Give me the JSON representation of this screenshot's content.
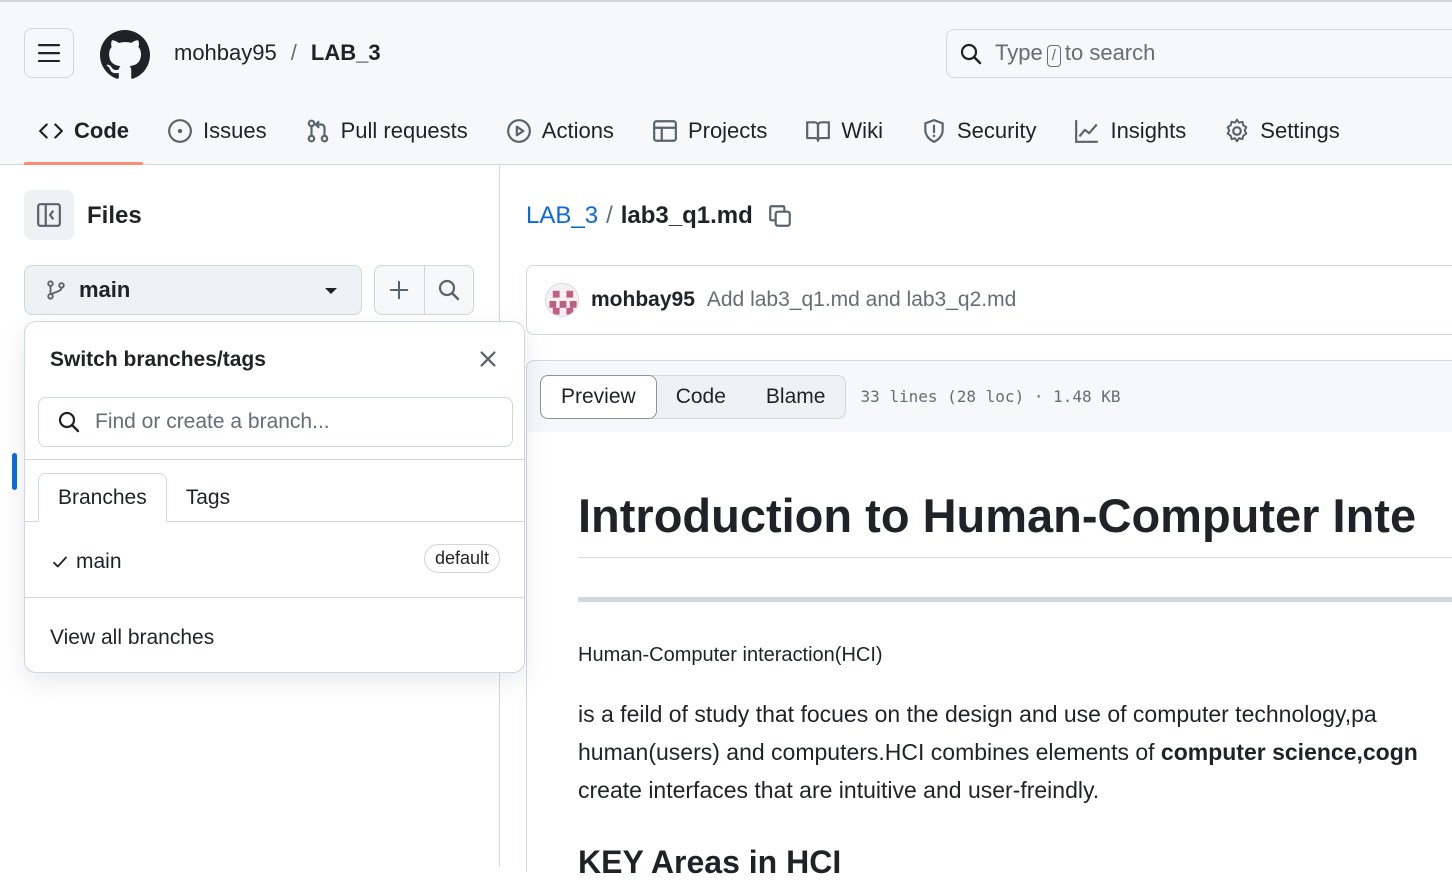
{
  "header": {
    "owner": "mohbay95",
    "separator": "/",
    "repo": "LAB_3",
    "search": {
      "prefix": "Type",
      "key": "/",
      "suffix": "to search"
    }
  },
  "tabs": [
    {
      "label": "Code",
      "icon": "code-icon",
      "active": true
    },
    {
      "label": "Issues",
      "icon": "issue-opened-icon"
    },
    {
      "label": "Pull requests",
      "icon": "git-pull-request-icon"
    },
    {
      "label": "Actions",
      "icon": "play-icon"
    },
    {
      "label": "Projects",
      "icon": "table-icon"
    },
    {
      "label": "Wiki",
      "icon": "book-icon"
    },
    {
      "label": "Security",
      "icon": "shield-icon"
    },
    {
      "label": "Insights",
      "icon": "graph-icon"
    },
    {
      "label": "Settings",
      "icon": "gear-icon"
    }
  ],
  "filepane": {
    "title": "Files",
    "branch": "main"
  },
  "branch_dropdown": {
    "title": "Switch branches/tags",
    "search_placeholder": "Find or create a branch...",
    "tabs": [
      "Branches",
      "Tags"
    ],
    "branches": [
      {
        "name": "main",
        "badge": "default",
        "selected": true
      }
    ],
    "view_all": "View all branches"
  },
  "content": {
    "path": {
      "repo": "LAB_3",
      "separator": "/",
      "file": "lab3_q1.md"
    },
    "commit": {
      "author": "mohbay95",
      "message": "Add lab3_q1.md and lab3_q2.md"
    },
    "view_modes": [
      "Preview",
      "Code",
      "Blame"
    ],
    "file_info": "33 lines (28 loc) · 1.48 KB",
    "markdown": {
      "h1": "Introduction to Human-Computer Inte",
      "subheading": "Human-Computer interaction(HCI)",
      "para_line1": "is a feild of study that focues on the design and use of computer technology,pa",
      "para_line2_a": "human(users) and computers.HCI combines elements of ",
      "para_line2_b": "computer science,cogn",
      "para_line3": "create interfaces that are intuitive and user-freindly.",
      "h2": "KEY Areas in HCI"
    }
  },
  "colors": {
    "accent": "#0969da",
    "tab_underline": "#fd8c73",
    "border": "#d0d7de",
    "header_bg": "#f6f8fa"
  }
}
